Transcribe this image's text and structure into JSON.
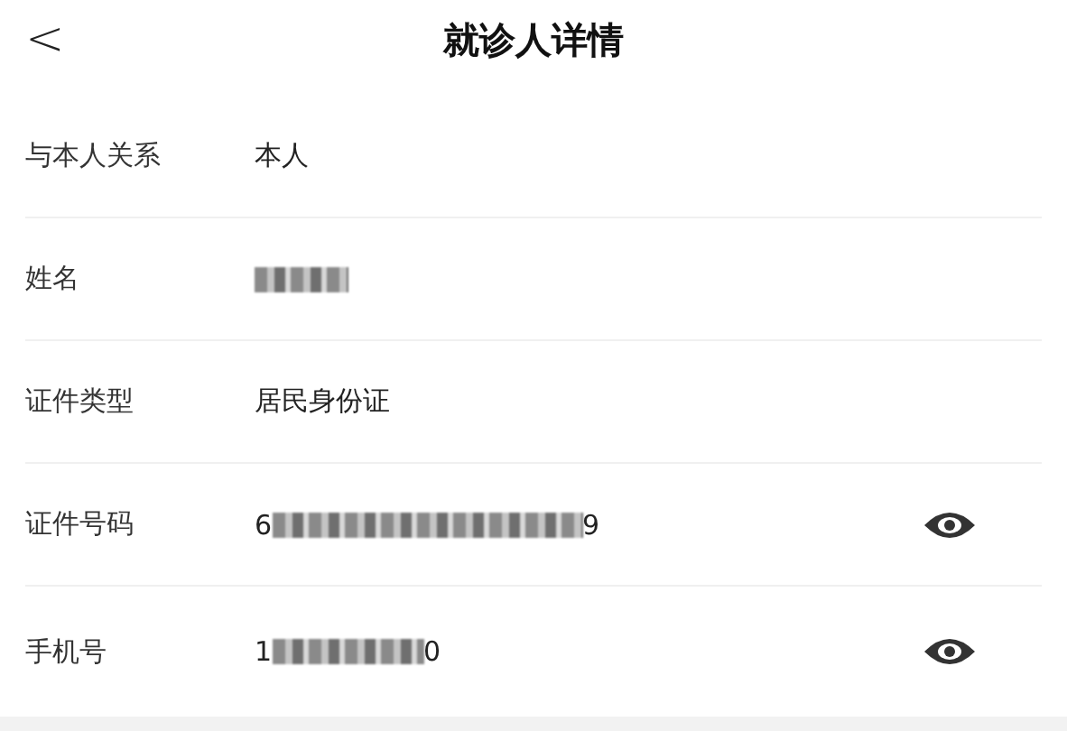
{
  "header": {
    "back": "<",
    "title": "就诊人详情"
  },
  "rows": [
    {
      "label": "与本人关系",
      "kind": "plain",
      "value": "本人",
      "eye_toggle": false
    },
    {
      "label": "姓名",
      "kind": "masked_name",
      "eye_toggle": false
    },
    {
      "label": "证件类型",
      "kind": "plain",
      "value": "居民身份证",
      "eye_toggle": false
    },
    {
      "label": "证件号码",
      "kind": "masked_id",
      "value_start": "6",
      "value_end": "9",
      "eye_toggle": true
    },
    {
      "label": "手机号",
      "kind": "masked_phone",
      "value_start": "1",
      "value_end": "0",
      "eye_toggle": true
    }
  ]
}
